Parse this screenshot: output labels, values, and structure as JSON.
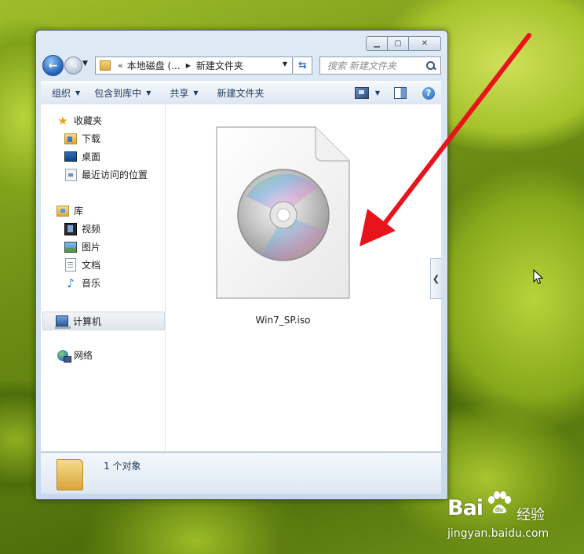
{
  "window": {
    "caption_buttons": [
      "minimize",
      "maximize",
      "close"
    ]
  },
  "address_bar": {
    "overflow_glyph": "«",
    "segments": [
      "本地磁盘 (...",
      "新建文件夹"
    ]
  },
  "search": {
    "placeholder": "搜索 新建文件夹"
  },
  "toolbar": {
    "organize": "组织",
    "include_in_library": "包含到库中",
    "share": "共享",
    "new_folder": "新建文件夹"
  },
  "nav": {
    "favorites": "收藏夹",
    "downloads": "下载",
    "desktop": "桌面",
    "recent": "最近访问的位置",
    "libraries": "库",
    "videos": "视频",
    "pictures": "图片",
    "documents": "文档",
    "music": "音乐",
    "computer": "计算机",
    "network": "网络"
  },
  "files": [
    {
      "name": "Win7_SP.iso",
      "icon": "disc-image-icon"
    }
  ],
  "details": {
    "count_text": "1 个对象"
  },
  "annotation": {
    "arrow_color": "#e8141c"
  },
  "watermark": {
    "logo_text": "Bai",
    "logo_suffix": "经验",
    "url": "jingyan.baidu.com"
  }
}
